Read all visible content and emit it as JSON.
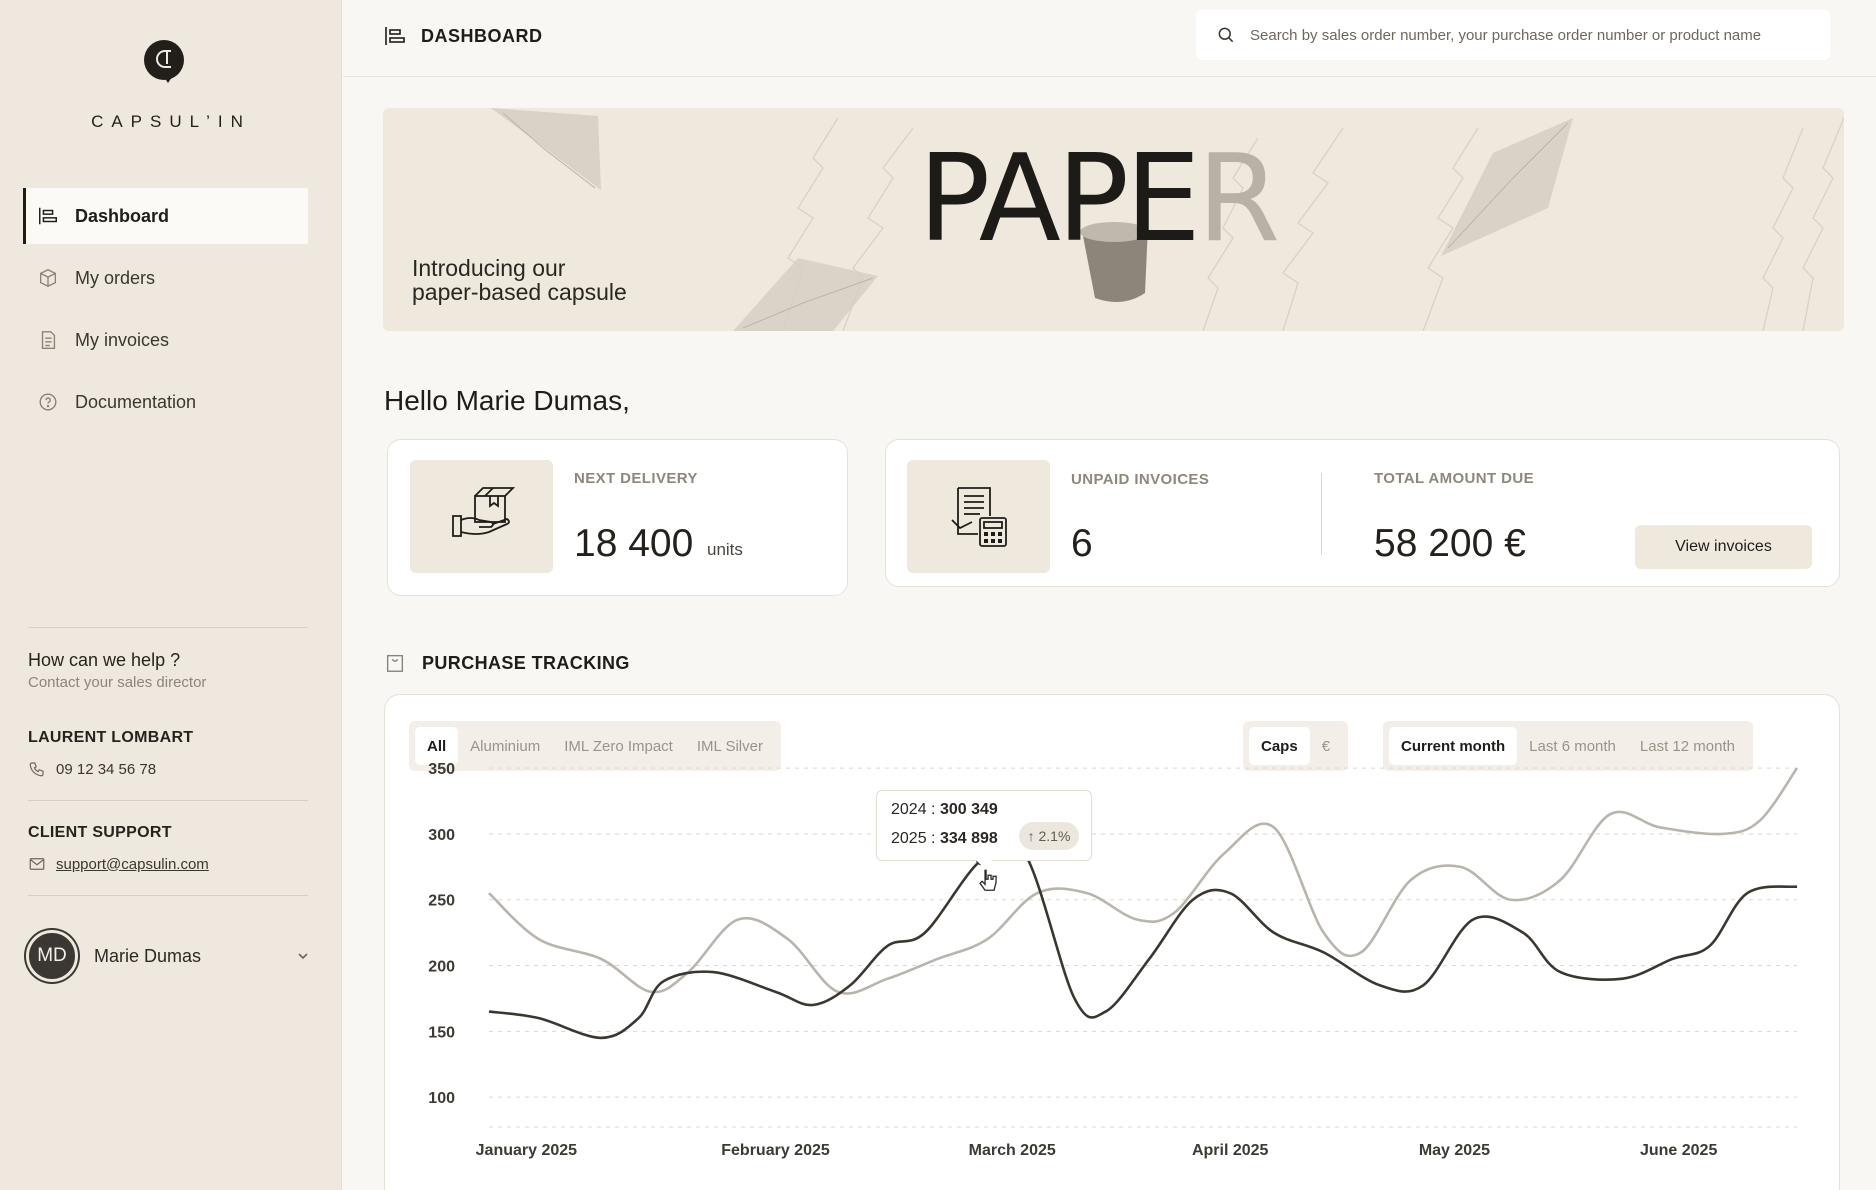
{
  "brand": {
    "name": "CAPSUL’IN"
  },
  "sidebar": {
    "items": [
      {
        "label": "Dashboard",
        "icon": "dashboard-icon",
        "active": true
      },
      {
        "label": "My orders",
        "icon": "box-icon"
      },
      {
        "label": "My invoices",
        "icon": "invoice-icon"
      },
      {
        "label": "Documentation",
        "icon": "help-circle-icon"
      }
    ],
    "help": {
      "title": "How can we help ?",
      "subtitle": "Contact your sales director"
    },
    "director": {
      "title": "LAURENT LOMBART",
      "phone": "09 12 34 56 78"
    },
    "support": {
      "title": "CLIENT SUPPORT",
      "email": "support@capsulin.com"
    },
    "user": {
      "initials": "MD",
      "name": "Marie Dumas"
    }
  },
  "header": {
    "title": "DASHBOARD",
    "search_placeholder": "Search by sales order number, your purchase order number or product name"
  },
  "banner": {
    "line1": "Introducing our",
    "line2": "paper-based capsule",
    "word_main": "PAPE",
    "word_tail": "R"
  },
  "greeting": "Hello Marie Dumas,",
  "cards": {
    "next_delivery": {
      "label": "NEXT DELIVERY",
      "value": "18 400",
      "unit": "units"
    },
    "unpaid_invoices": {
      "label": "UNPAID INVOICES",
      "value": "6"
    },
    "total_due": {
      "label": "TOTAL AMOUNT DUE",
      "value": "58 200 €"
    },
    "view_invoices": "View invoices"
  },
  "purchase_tracking": {
    "title": "PURCHASE TRACKING",
    "filters": [
      {
        "label": "All",
        "active": true
      },
      {
        "label": "Aluminium"
      },
      {
        "label": "IML Zero Impact"
      },
      {
        "label": "IML Silver"
      }
    ],
    "units": [
      {
        "label": "Caps",
        "active": true
      },
      {
        "label": "€"
      }
    ],
    "periods": [
      {
        "label": "Current month",
        "active": true
      },
      {
        "label": "Last 6 month"
      },
      {
        "label": "Last 12 month"
      }
    ],
    "tooltip": {
      "row1_label": "2024 :",
      "row1_value": "300 349",
      "row2_label": "2025 :",
      "row2_value": "334 898",
      "change": "↑ 2.1%"
    }
  },
  "colors": {
    "sidebar_bg": "#efe8de",
    "page_bg": "#f8f7f3",
    "series_2025": "#3b3730",
    "series_2024": "#b9b4ac"
  },
  "chart_data": {
    "type": "line",
    "yticks": [
      350,
      300,
      250,
      200,
      150,
      100
    ],
    "ylim": [
      75,
      360
    ],
    "x_ticks": [
      "January 2025",
      "February 2025",
      "March 2025",
      "April 2025",
      "May 2025",
      "June 2025"
    ],
    "x_tick_positions": [
      0.3,
      2.3,
      4.2,
      5.95,
      7.75,
      9.55
    ],
    "xlim": [
      0,
      10.5
    ],
    "series": [
      {
        "name": "2025",
        "color": "#3b3730",
        "x": [
          0,
          0.4,
          0.9,
          1.2,
          1.4,
          1.8,
          2.3,
          2.6,
          2.9,
          3.2,
          3.5,
          3.95,
          4.3,
          4.7,
          4.95,
          5.3,
          5.65,
          5.95,
          6.3,
          6.7,
          7.15,
          7.5,
          7.9,
          8.3,
          8.6,
          9.1,
          9.5,
          9.8,
          10.1,
          10.5
        ],
        "values": [
          165,
          160,
          145,
          160,
          188,
          195,
          180,
          170,
          185,
          215,
          225,
          280,
          285,
          175,
          165,
          205,
          250,
          255,
          225,
          210,
          185,
          185,
          235,
          225,
          195,
          190,
          205,
          215,
          255,
          260
        ]
      },
      {
        "name": "2024",
        "color": "#b9b4ac",
        "x": [
          0,
          0.4,
          0.9,
          1.3,
          1.6,
          2.0,
          2.4,
          2.8,
          3.2,
          3.6,
          4.0,
          4.4,
          4.8,
          5.2,
          5.5,
          5.9,
          6.3,
          6.7,
          7.0,
          7.4,
          7.8,
          8.2,
          8.6,
          9.0,
          9.4,
          9.9,
          10.2,
          10.5
        ],
        "values": [
          255,
          220,
          205,
          180,
          195,
          235,
          220,
          180,
          190,
          205,
          220,
          255,
          255,
          235,
          240,
          285,
          305,
          225,
          210,
          265,
          275,
          250,
          265,
          315,
          305,
          300,
          310,
          350
        ]
      }
    ],
    "highlight": {
      "series": "2025",
      "x": 3.95,
      "value": 280
    }
  }
}
